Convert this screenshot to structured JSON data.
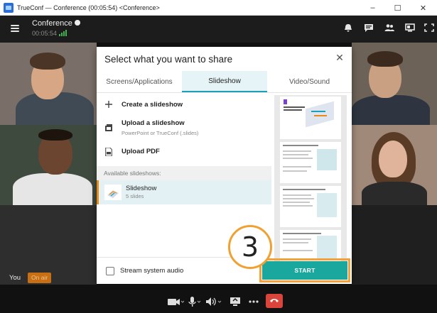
{
  "window": {
    "title": "TrueConf — Conference (00:05:54) <Conference>",
    "min": "–",
    "max": "☐",
    "close": "✕"
  },
  "conference": {
    "title": "Conference",
    "time": "00:05:54"
  },
  "dialog": {
    "title": "Select what you want to share",
    "close": "✕",
    "tabs": [
      {
        "label": "Screens/Applications",
        "active": false
      },
      {
        "label": "Slideshow",
        "active": true
      },
      {
        "label": "Video/Sound",
        "active": false
      }
    ],
    "actions": [
      {
        "label": "Create a slideshow",
        "sub": ""
      },
      {
        "label": "Upload a slideshow",
        "sub": "PowerPoint or TrueConf (.slides)"
      },
      {
        "label": "Upload PDF",
        "sub": ""
      }
    ],
    "available_header": "Available slideshows:",
    "slideshows": [
      {
        "name": "Slideshow",
        "count": "5 slides",
        "selected": true
      }
    ],
    "stream_audio_label": "Stream system audio",
    "stream_audio_checked": false,
    "start_label": "START"
  },
  "step_badge": "3",
  "self_view": {
    "label": "You",
    "status": "On air"
  },
  "colors": {
    "accent": "#1aa0b8",
    "start": "#1aa79e",
    "highlight": "#f0a132",
    "hangup": "#d9443b"
  },
  "icons": [
    "menu-icon",
    "info-icon",
    "signal-icon",
    "raise-hand-icon",
    "chat-icon",
    "participants-icon",
    "layout-icon",
    "fullscreen-icon",
    "plus-icon",
    "upload-icon",
    "pdf-icon",
    "camera-icon",
    "microphone-icon",
    "speaker-icon",
    "share-screen-icon",
    "more-icon",
    "hangup-icon"
  ]
}
